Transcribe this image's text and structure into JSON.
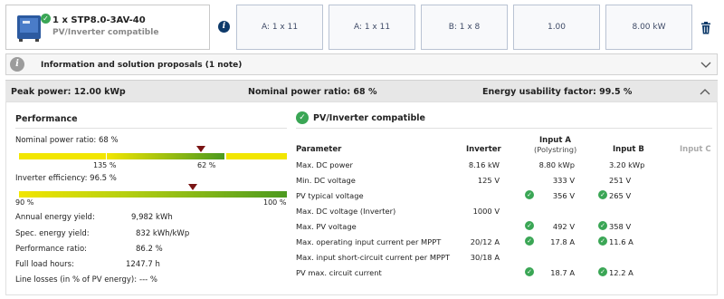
{
  "product": {
    "title": "1 x STP8.0-3AV-40",
    "subtitle": "PV/Inverter compatible"
  },
  "config_boxes": [
    "A: 1 x 11",
    "A: 1 x 11",
    "B: 1 x 8",
    "1.00",
    "8.00 kW"
  ],
  "info_bar": {
    "label": "Information and solution proposals (1 note)"
  },
  "summary": {
    "peak_power": "Peak power: 12.00 kWp",
    "nominal_ratio": "Nominal power ratio: 68 %",
    "energy_factor": "Energy usability factor: 99.5 %"
  },
  "performance": {
    "title": "Performance",
    "nominal_label": "Nominal power ratio: 68 %",
    "nominal_ticks": {
      "left": "135 %",
      "right": "62 %"
    },
    "nominal_marker_fraction": 0.68,
    "efficiency_label": "Inverter efficiency: 96.5 %",
    "efficiency_ticks": {
      "left": "90 %",
      "right": "100 %"
    },
    "efficiency_marker_fraction": 0.65,
    "rows": [
      {
        "label": "Annual energy yield:",
        "value": "9,982 kWh"
      },
      {
        "label": "Spec. energy yield:",
        "value": "832 kWh/kWp"
      },
      {
        "label": "Performance ratio:",
        "value": "86.2 %"
      },
      {
        "label": "Full load hours:",
        "value": "1247.7 h"
      },
      {
        "label": "Line losses (in % of PV energy):",
        "value": "--- %"
      }
    ]
  },
  "compat": {
    "title": "PV/Inverter compatible",
    "headers": {
      "parameter": "Parameter",
      "inverter": "Inverter",
      "inputA": "Input A",
      "inputA_sub": "(Polystring)",
      "inputB": "Input B",
      "inputC": "Input C"
    },
    "rows": [
      {
        "param": "Max. DC power",
        "inverter": "8.16 kW",
        "a": "8.80 kWp",
        "a_check": false,
        "b": "3.20 kWp",
        "b_check": false
      },
      {
        "param": "Min. DC voltage",
        "inverter": "125 V",
        "a": "333 V",
        "a_check": false,
        "b": "251 V",
        "b_check": false
      },
      {
        "param": "PV typical voltage",
        "inverter": "",
        "a": "356 V",
        "a_check": true,
        "b": "265 V",
        "b_check": true
      },
      {
        "param": "Max. DC voltage (Inverter)",
        "inverter": "1000 V",
        "a": "",
        "a_check": false,
        "b": "",
        "b_check": false
      },
      {
        "param": "Max. PV voltage",
        "inverter": "",
        "a": "492 V",
        "a_check": true,
        "b": "358 V",
        "b_check": true
      },
      {
        "param": "Max. operating input current per MPPT",
        "inverter": "20/12 A",
        "a": "17.8 A",
        "a_check": true,
        "b": "11.6 A",
        "b_check": true
      },
      {
        "param": "Max. input short-circuit current per MPPT",
        "inverter": "30/18 A",
        "a": "",
        "a_check": false,
        "b": "",
        "b_check": false
      },
      {
        "param": "PV max. circuit current",
        "inverter": "",
        "a": "18.7 A",
        "a_check": true,
        "b": "12.2 A",
        "b_check": true
      }
    ]
  },
  "colors": {
    "green": "#3aa655",
    "yellow": "#f2e600",
    "gauge_green": "#4c9a1f",
    "marker": "#7a1414",
    "navy": "#0e3a6a"
  }
}
